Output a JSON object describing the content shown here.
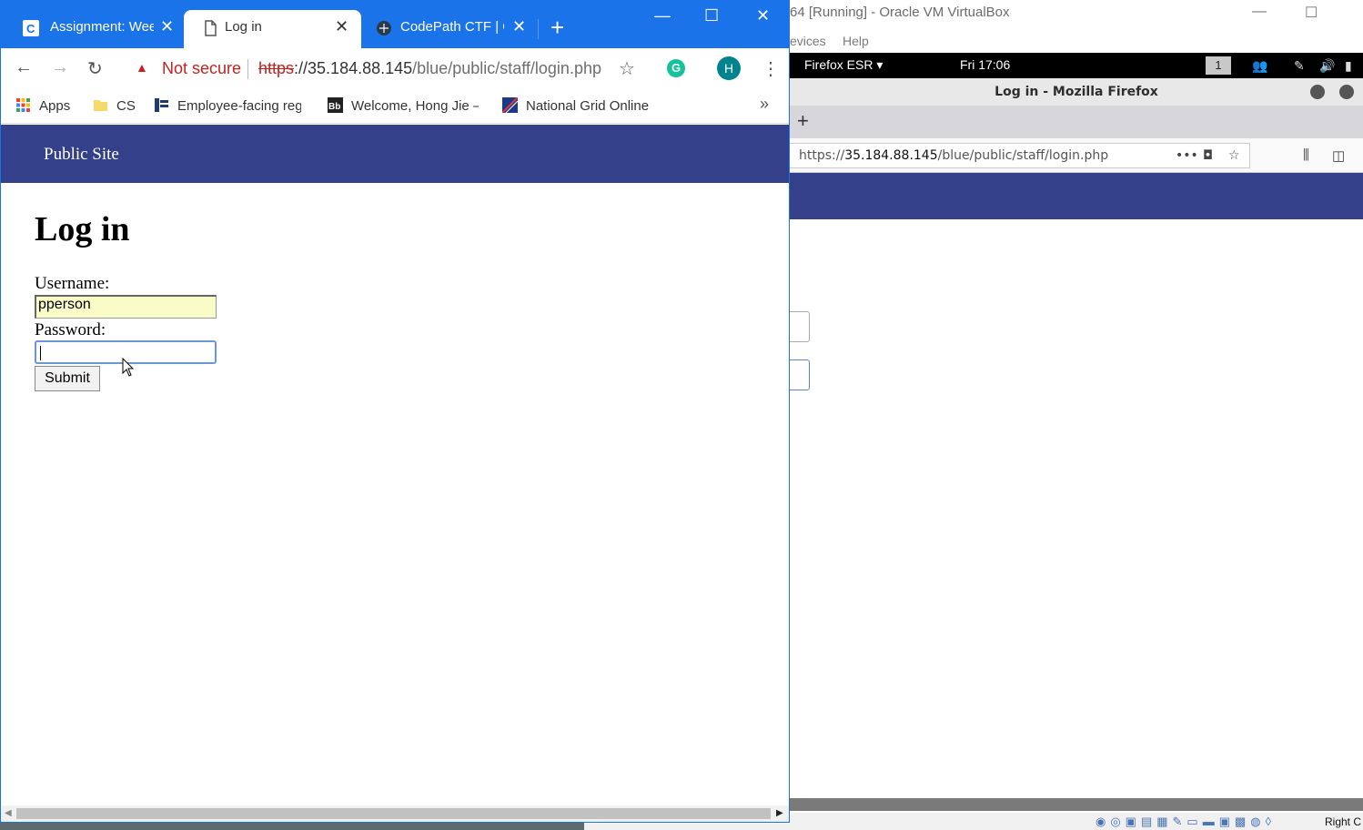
{
  "vbox": {
    "title": "64 [Running] - Oracle VM VirtualBox",
    "menu": [
      "evices",
      "Help"
    ],
    "statusbar_hostkey": "Right C"
  },
  "guest": {
    "topbar": {
      "app_menu": "Firefox ESR",
      "clock": "Fri 17:06",
      "workspace": "1"
    },
    "firefox": {
      "window_title": "Log in - Mozilla Firefox",
      "url_prefix": "https://",
      "url_host": "35.184.88.145",
      "url_path": "/blue/public/staff/login.php"
    }
  },
  "chrome": {
    "tabs": [
      {
        "label": "Assignment: Wee",
        "active": false
      },
      {
        "label": "Log in",
        "active": true
      },
      {
        "label": "CodePath CTF | G",
        "active": false
      }
    ],
    "security_label": "Not secure",
    "url": {
      "scheme": "https",
      "rest_host": "://35.184.88.145",
      "path": "/blue/public/staff/login.php"
    },
    "profile_initial": "H",
    "grammarly": "G",
    "bookmarks": [
      {
        "label": "Apps",
        "icon": "apps-grid-icon"
      },
      {
        "label": "CS",
        "icon": "folder-icon"
      },
      {
        "label": "Employee-facing reg",
        "icon": "site-favicon"
      },
      {
        "label": "Welcome, Hong Jie –",
        "icon": "blackboard-icon"
      },
      {
        "label": "National Grid Online",
        "icon": "national-grid-icon"
      }
    ],
    "bookmarks_more": "»"
  },
  "page": {
    "site_name": "Public Site",
    "heading": "Log in",
    "username_label": "Username:",
    "username_value": "pperson",
    "password_label": "Password:",
    "password_value": "",
    "submit_label": "Submit"
  },
  "colors": {
    "chrome_accent": "#1a73e8",
    "site_header": "#34418a",
    "autofill": "#fafcc8",
    "not_secure": "#c5221f"
  }
}
